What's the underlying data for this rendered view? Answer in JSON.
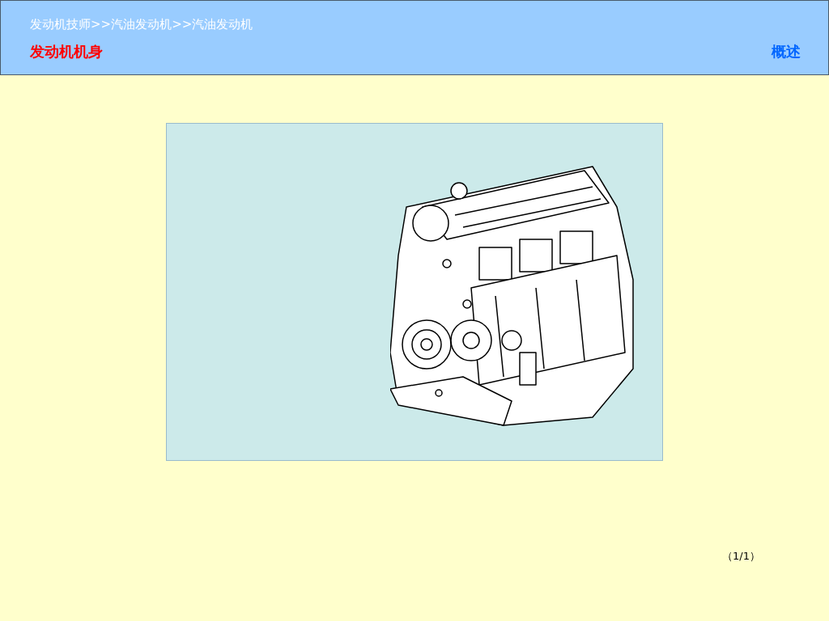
{
  "header": {
    "breadcrumb": "发动机技师>>汽油发动机>>汽油发动机",
    "title": "发动机机身",
    "section_link": "概述"
  },
  "pager": "（1/1）"
}
